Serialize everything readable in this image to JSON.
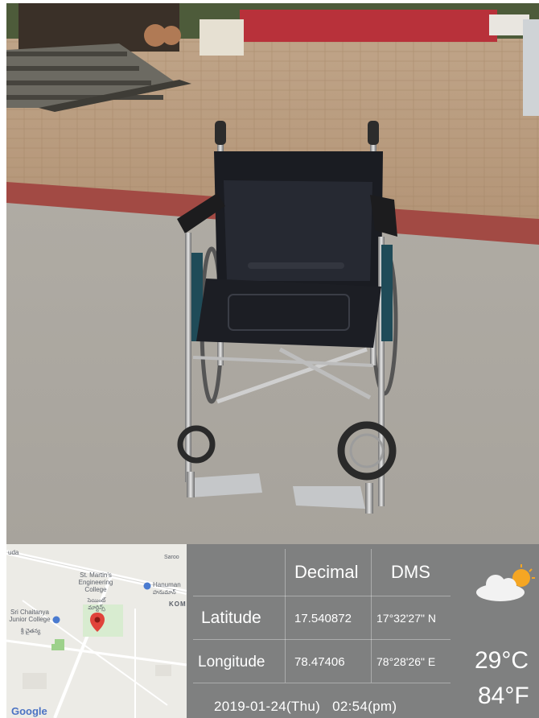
{
  "map": {
    "labels": {
      "top_left": "uda",
      "top_right": "Saroo",
      "college": "St. Martin's Engineering College",
      "college_te": "సెయింట్ మార్టిన్స్",
      "hanuman": "Hanuman",
      "hanuman_te": "హనుమాన్",
      "kom": "KOM",
      "junior": "Sri Chaitanya Junior College",
      "junior_te": "శ్రీ చైతన్య",
      "google": "Google"
    }
  },
  "info": {
    "headers": {
      "decimal": "Decimal",
      "dms": "DMS"
    },
    "rows": [
      {
        "label": "Latitude",
        "decimal": "17.540872",
        "dms": "17°32'27\" N"
      },
      {
        "label": "Longitude",
        "decimal": "78.47406",
        "dms": "78°28'26\" E"
      }
    ],
    "datetime": "2019-01-24(Thu)   02:54(pm)",
    "weather": {
      "temp_c": "29°C",
      "temp_f": "84°F",
      "icon": "partly-cloudy-icon"
    }
  }
}
